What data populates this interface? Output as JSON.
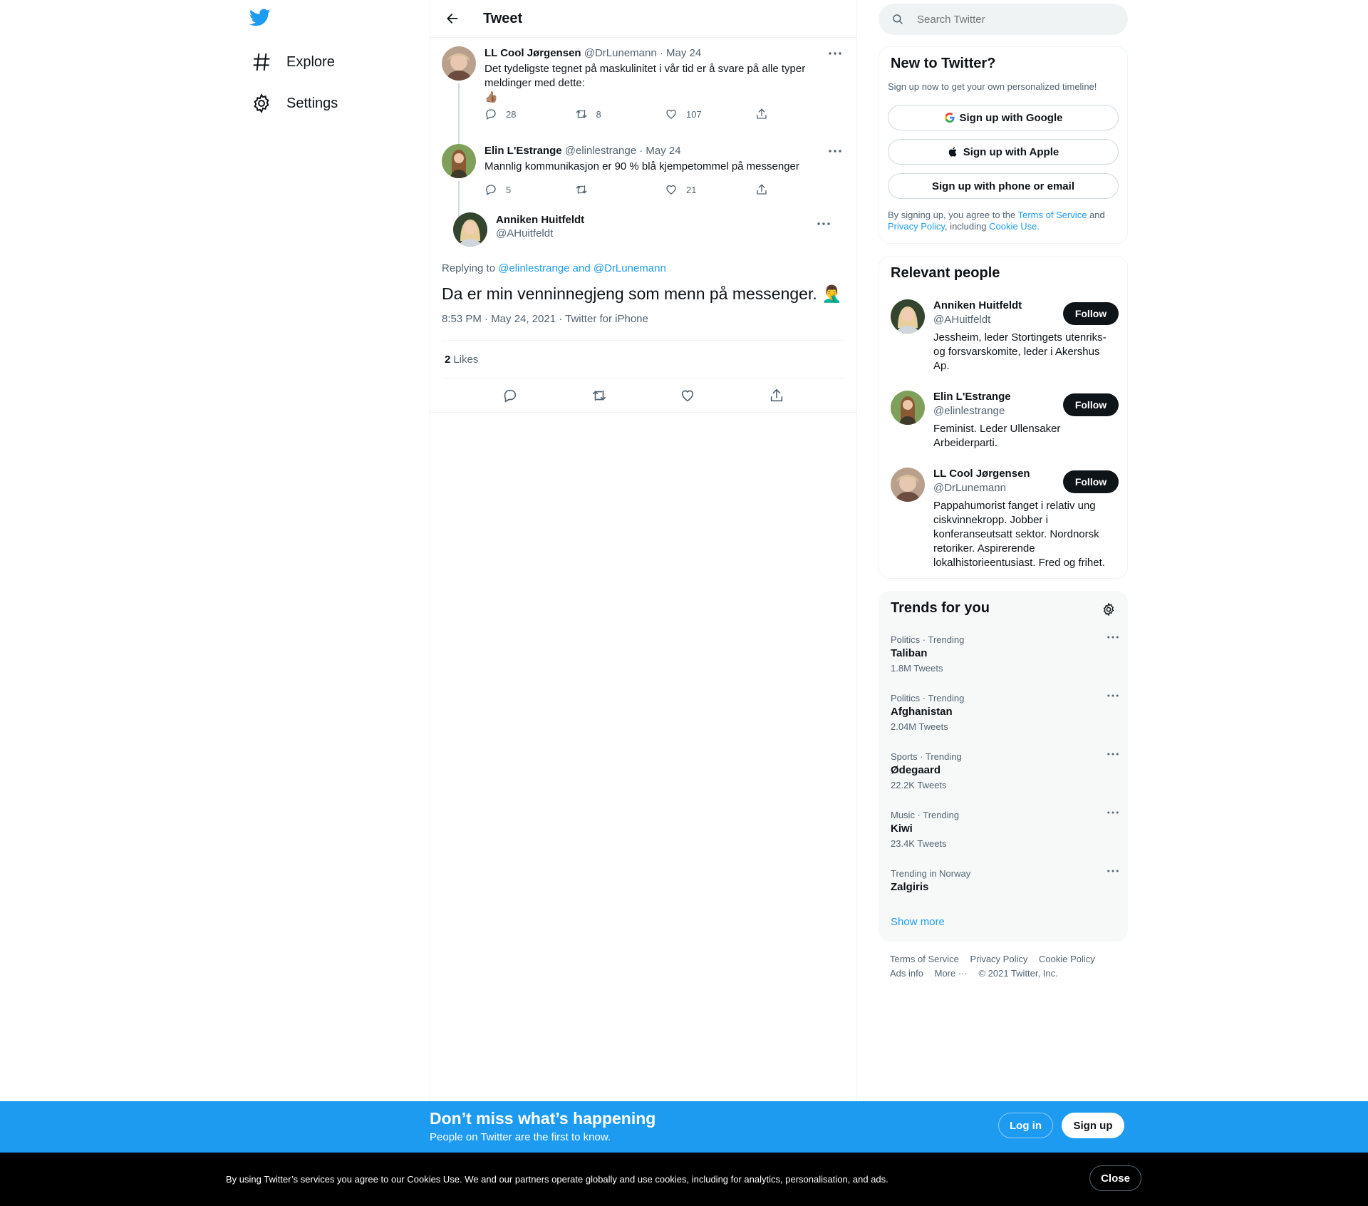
{
  "nav": {
    "logo": "twitter-bird-icon",
    "items": [
      {
        "icon": "hashtag-icon",
        "label": "Explore"
      },
      {
        "icon": "gear-icon",
        "label": "Settings"
      }
    ]
  },
  "header": {
    "title": "Tweet"
  },
  "thread": [
    {
      "name": "LL Cool Jørgensen",
      "handle": "@DrLunemann",
      "date": "May 24",
      "text_line1": "Det tydeligste tegnet på maskulinitet i vår tid er å svare på alle typer",
      "text_line2": "meldinger med dette:",
      "emoji": "👍🏽",
      "replies": "28",
      "retweets": "8",
      "likes": "107"
    },
    {
      "name": "Elin L'Estrange",
      "handle": "@elinlestrange",
      "date": "May 24",
      "text_line1": "Mannlig kommunikasjon er 90 % blå kjempetommel på messenger",
      "replies": "5",
      "retweets": "",
      "likes": "21"
    }
  ],
  "focus": {
    "name": "Anniken Huitfeldt",
    "handle": "@AHuitfeldt",
    "replying_prefix": "Replying to",
    "replying_to": "@elinlestrange and @DrLunemann",
    "text": "Da er min venninnegjeng som menn på messenger.",
    "emoji": "🤦‍♂️",
    "timestamp": "8:53 PM · May 24, 2021 · Twitter for iPhone",
    "likes_count": "2",
    "likes_label": "Likes"
  },
  "search": {
    "placeholder": "Search Twitter"
  },
  "new_to_twitter": {
    "title": "New to Twitter?",
    "subtitle": "Sign up now to get your own personalized timeline!",
    "google": "Sign up with Google",
    "apple": "Sign up with Apple",
    "phone": "Sign up with phone or email",
    "legal_1": "By signing up, you agree to the",
    "tos": "Terms of Service",
    "and": "and",
    "privacy": "Privacy Policy",
    "including": ", including",
    "cookie": "Cookie Use."
  },
  "relevant": {
    "title": "Relevant people",
    "follow_label": "Follow",
    "people": [
      {
        "name": "Anniken Huitfeldt",
        "handle": "@AHuitfeldt",
        "bio": [
          "Jessheim, leder Stortingets utenriks-",
          "og forsvarskomite, leder i Akershus",
          "Ap."
        ]
      },
      {
        "name": "Elin L'Estrange",
        "handle": "@elinlestrange",
        "bio": [
          "Feminist. Leder Ullensaker",
          "Arbeiderparti."
        ]
      },
      {
        "name": "LL Cool Jørgensen",
        "handle": "@DrLunemann",
        "bio": [
          "Pappahumorist fanget i relativ ung",
          "ciskvinnekropp. Jobber i",
          "konferanseutsatt sektor. Nordnorsk",
          "retoriker. Aspirerende",
          "lokalhistorieentusiast. Fred og frihet."
        ]
      }
    ]
  },
  "trends": {
    "title": "Trends for you",
    "items": [
      {
        "context": "Politics · Trending",
        "name": "Taliban",
        "count": "1.8M Tweets"
      },
      {
        "context": "Politics · Trending",
        "name": "Afghanistan",
        "count": "2.04M Tweets"
      },
      {
        "context": "Sports · Trending",
        "name": "Ødegaard",
        "count": "22.2K Tweets"
      },
      {
        "context": "Music · Trending",
        "name": "Kiwi",
        "count": "23.4K Tweets"
      },
      {
        "context": "Trending in Norway",
        "name": "Zalgiris",
        "count": ""
      }
    ],
    "show_more": "Show more"
  },
  "footer": {
    "tos": "Terms of Service",
    "privacy": "Privacy Policy",
    "cookie": "Cookie Policy",
    "ads": "Ads info",
    "more": "More ···",
    "copyright": "© 2021 Twitter, Inc."
  },
  "signup_bar": {
    "title": "Don’t miss what’s happening",
    "subtitle": "People on Twitter are the first to know.",
    "login": "Log in",
    "signup": "Sign up"
  },
  "cookie_bar": {
    "text": "By using Twitter’s services you agree to our Cookies Use. We and our partners operate globally and use cookies, including for analytics, personalisation, and ads.",
    "close": "Close"
  },
  "colors": {
    "accent": "#1d9bf0",
    "text": "#0f1419",
    "secondary": "#536471",
    "border": "#eff3f4"
  }
}
